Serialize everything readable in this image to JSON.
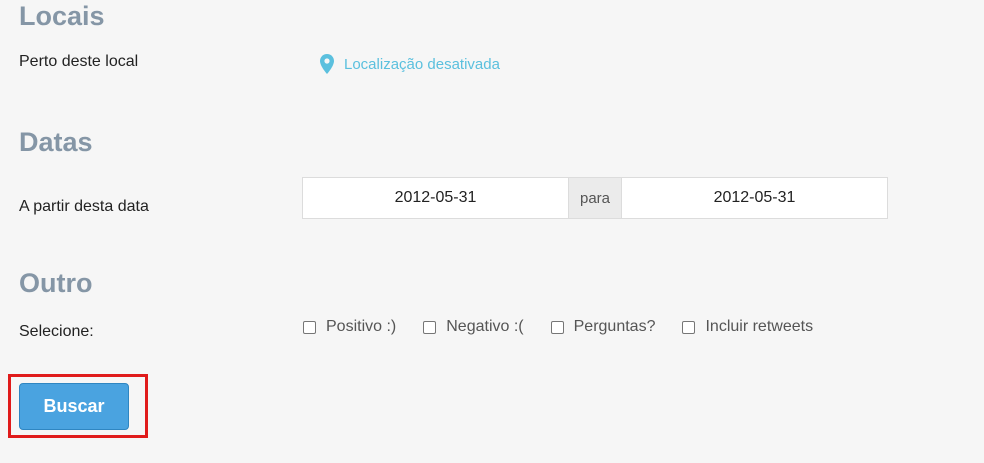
{
  "locais": {
    "title": "Locais",
    "near_label": "Perto deste local",
    "location_link": "Localização desativada",
    "location_icon": "map-pin-icon",
    "link_color": "#5bc0de"
  },
  "datas": {
    "title": "Datas",
    "from_label": "A partir desta data",
    "start_date": "2012-05-31",
    "separator": "para",
    "end_date": "2012-05-31"
  },
  "outro": {
    "title": "Outro",
    "select_label": "Selecione:",
    "options": [
      {
        "label": "Positivo :)",
        "checked": false
      },
      {
        "label": "Negativo :(",
        "checked": false
      },
      {
        "label": "Perguntas?",
        "checked": false
      },
      {
        "label": "Incluir retweets",
        "checked": false
      }
    ]
  },
  "search_button": {
    "label": "Buscar",
    "color": "#4aa3e0",
    "highlight_color": "#e01b1b"
  }
}
